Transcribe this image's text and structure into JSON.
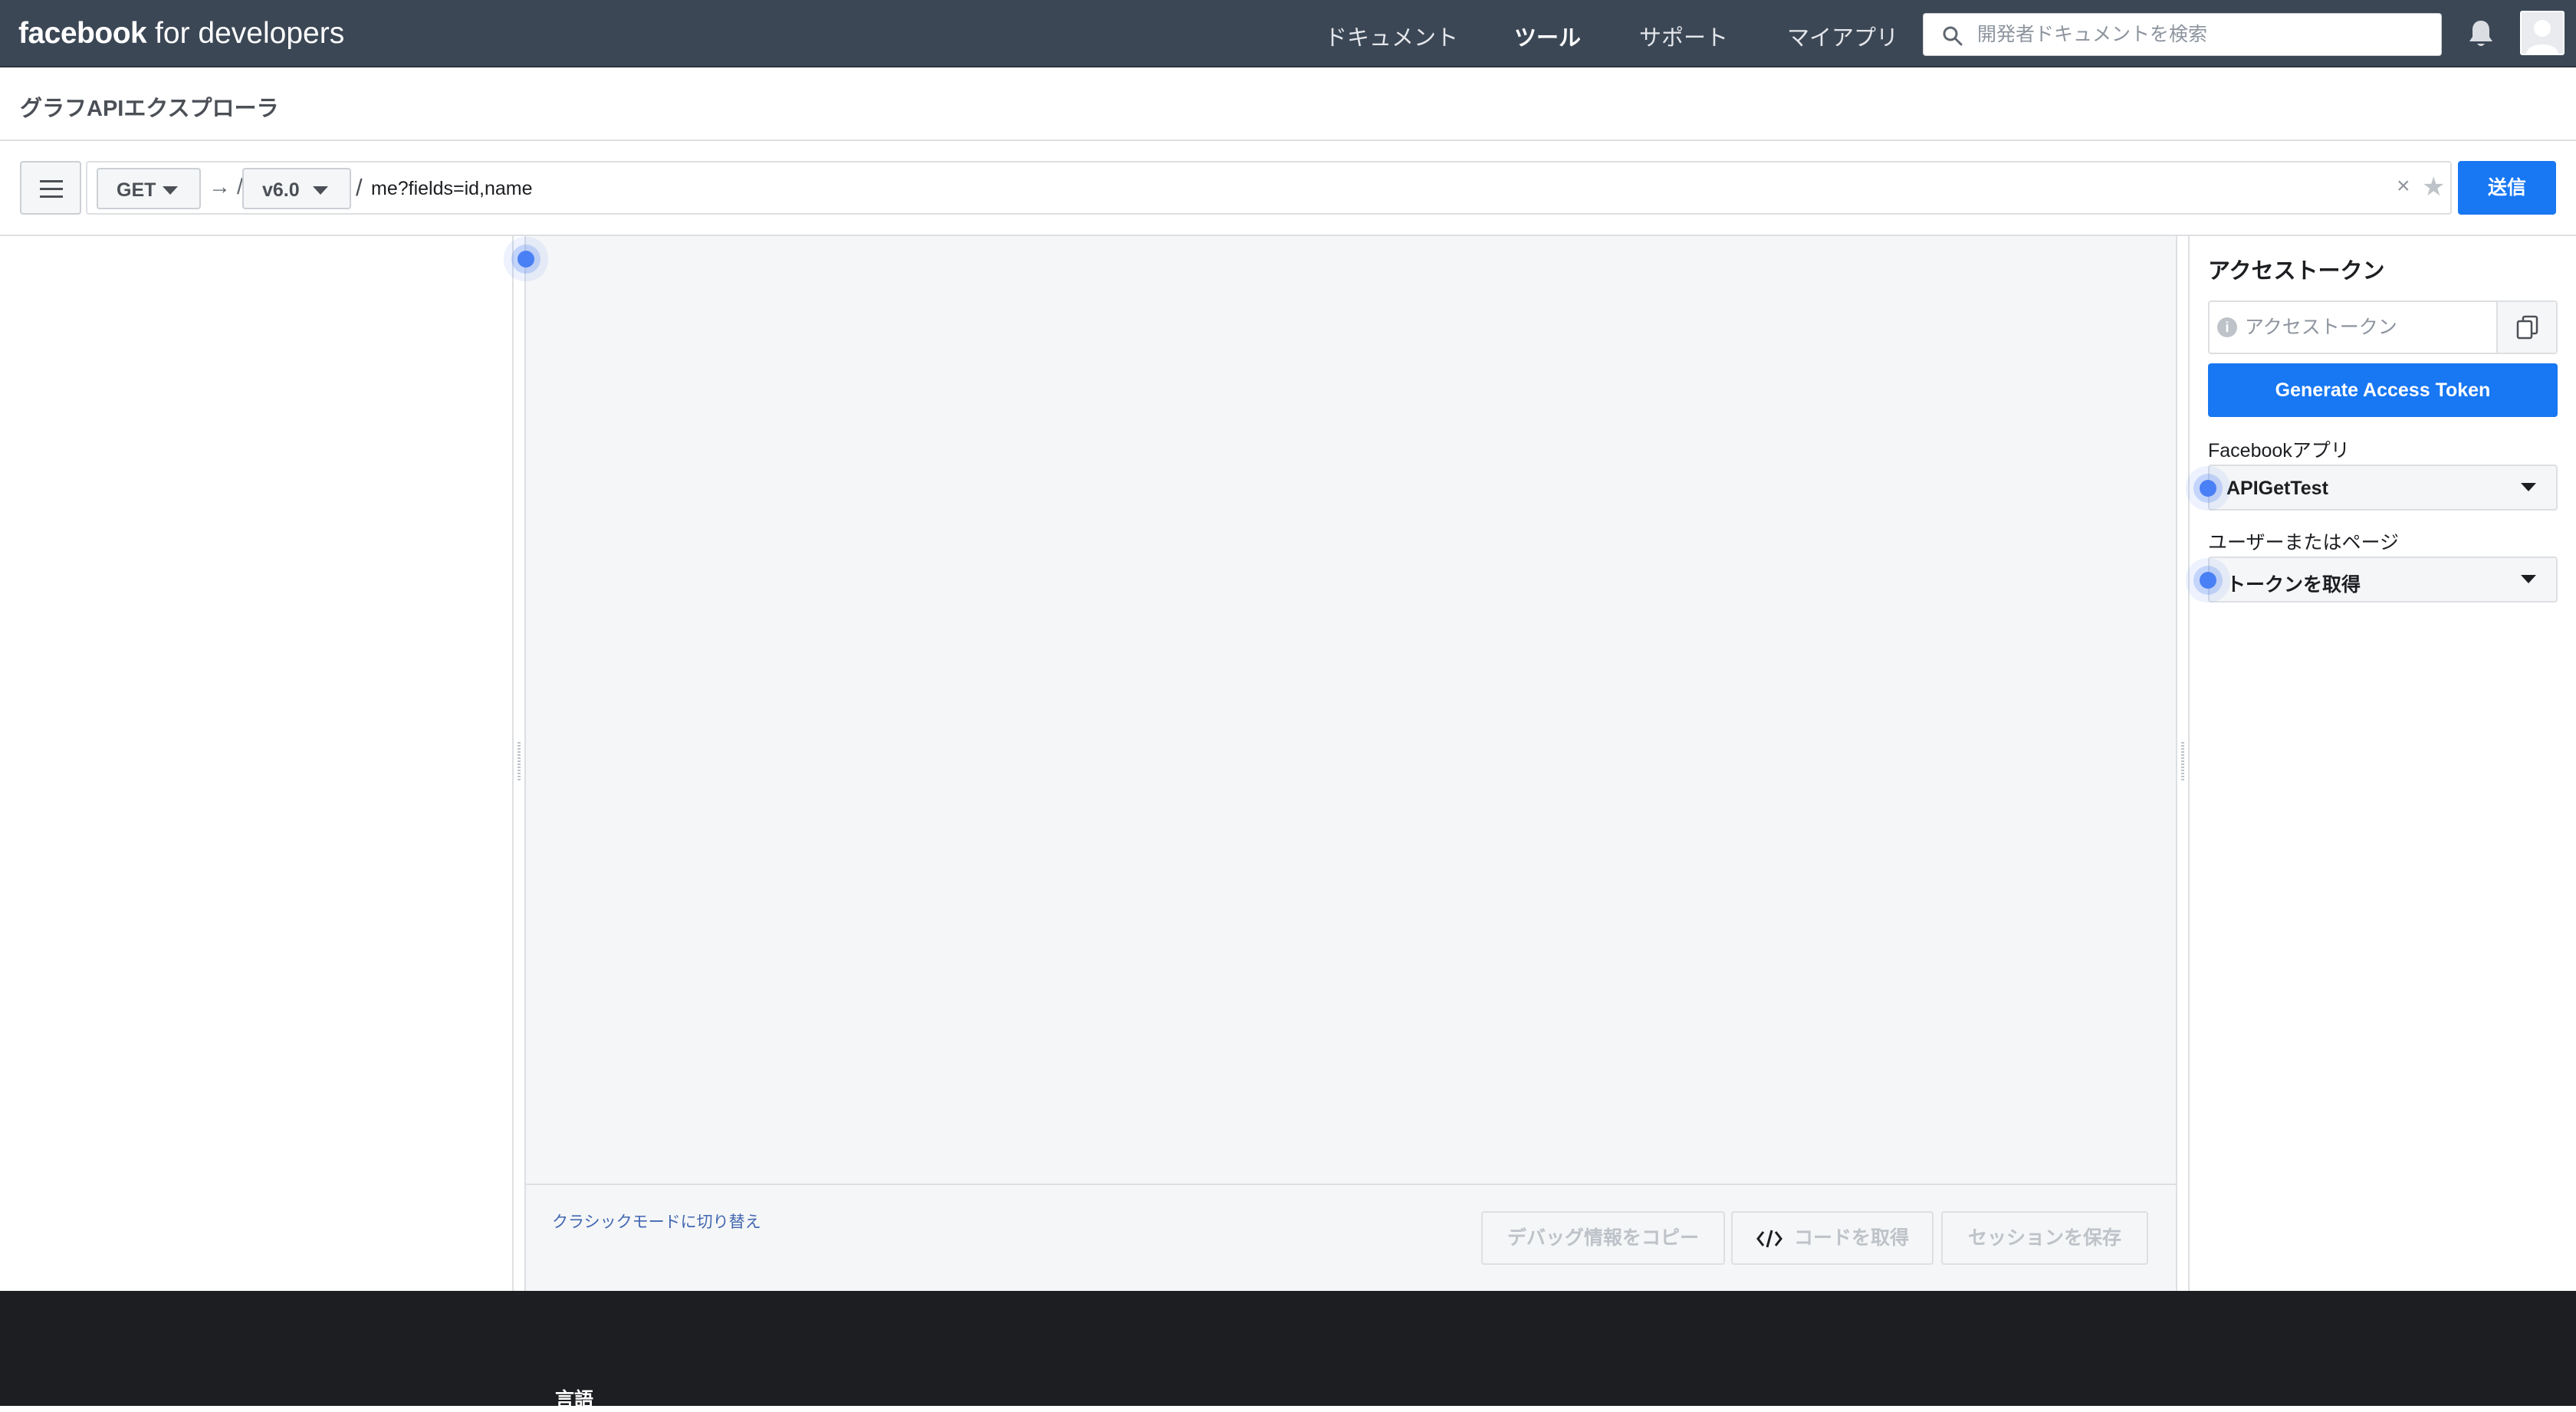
{
  "header": {
    "brand_bold": "facebook",
    "brand_rest": " for developers",
    "nav": [
      "ドキュメント",
      "ツール",
      "サポート",
      "マイアプリ"
    ],
    "active_nav": "ツール",
    "search_placeholder": "開発者ドキュメントを検索"
  },
  "page": {
    "title": "グラフAPIエクスプローラ"
  },
  "query": {
    "method": "GET",
    "arrow": "→ /",
    "version": "v6.0",
    "slash": "/",
    "path": "me?fields=id,name",
    "clear_symbol": "×",
    "star_symbol": "★",
    "submit_label": "送信"
  },
  "center": {
    "classic_link": "クラシックモードに切り替え",
    "buttons": {
      "copy_debug": "デバッグ情報をコピー",
      "get_code": "コードを取得",
      "save_session": "セッションを保存"
    }
  },
  "side_panel": {
    "title": "アクセストークン",
    "token_placeholder": "アクセストークン",
    "generate_label": "Generate Access Token",
    "app_label": "Facebookアプリ",
    "app_value": "APIGetTest",
    "user_label": "ユーザーまたはページ",
    "user_value": "トークンを取得"
  },
  "footer": {
    "language_label": "言語"
  },
  "icons": {
    "search": "search-icon",
    "bell": "bell-icon",
    "menu": "hamburger-icon",
    "copy": "copy-icon",
    "info": "info-icon",
    "code": "code-icon"
  },
  "colors": {
    "topbar": "#3b4755",
    "primary": "#1877f2",
    "link": "#4267b2",
    "footer": "#1c1e21",
    "pane_bg": "#f5f6f7"
  }
}
